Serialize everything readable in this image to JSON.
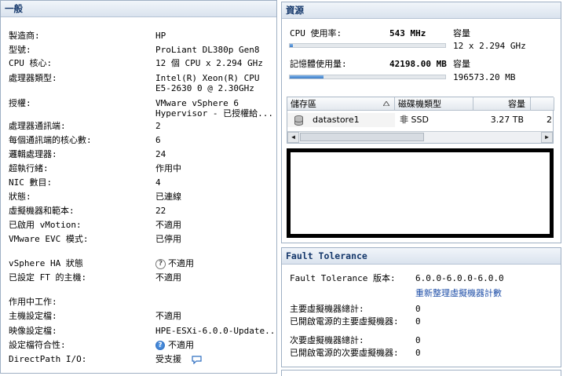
{
  "general": {
    "title": "一般",
    "rows": [
      {
        "key": "製造商:",
        "value": "HP"
      },
      {
        "key": "型號:",
        "value": "ProLiant DL380p Gen8"
      },
      {
        "key": "CPU 核心:",
        "value": "12 個 CPU x 2.294 GHz"
      },
      {
        "key": "處理器類型:",
        "value": "Intel(R) Xeon(R) CPU",
        "value2": "E5-2630 0 @ 2.30GHz"
      },
      {
        "key": "授權:",
        "value": "VMware vSphere 6",
        "value2": "Hypervisor - 已授權給..."
      },
      {
        "key": "處理器通訊端:",
        "value": "2"
      },
      {
        "key": "每個通訊端的核心數:",
        "value": "6"
      },
      {
        "key": "邏輯處理器:",
        "value": "24"
      },
      {
        "key": "超執行緒:",
        "value": "作用中"
      },
      {
        "key": "NIC 數目:",
        "value": "4"
      },
      {
        "key": "狀態:",
        "value": "已連線"
      },
      {
        "key": "虛擬機器和範本:",
        "value": "22"
      },
      {
        "key": "已啟用 vMotion:",
        "value": "不適用"
      },
      {
        "key": "VMware EVC 模式:",
        "value": "已停用"
      },
      {
        "key": "vSphere HA 狀態",
        "value": "不適用"
      },
      {
        "key": "已設定 FT 的主機:",
        "value": "不適用"
      },
      {
        "key": "作用中工作:",
        "value": ""
      },
      {
        "key": "主機設定檔:",
        "value": "不適用"
      },
      {
        "key": "映像設定檔:",
        "value": "HPE-ESXi-6.0.0-Update..."
      },
      {
        "key": "設定檔符合性:",
        "value": "不適用"
      },
      {
        "key": "DirectPath I/O:",
        "value": "受支援"
      }
    ]
  },
  "resources": {
    "title": "資源",
    "cpu": {
      "label": "CPU 使用率:",
      "value": "543 MHz",
      "cap_label": "容量",
      "capacity": "12 x 2.294 GHz",
      "fraction": 0.02
    },
    "mem": {
      "label": "記憶體使用量:",
      "value": "42198.00 MB",
      "cap_label": "容量",
      "capacity": "196573.20 MB",
      "fraction": 0.215
    },
    "table": {
      "headers": [
        "儲存區",
        "磁碟機類型",
        "容量"
      ],
      "rows": [
        {
          "name": "datastore1",
          "type": "非 SSD",
          "capacity": "3.27 TB",
          "more": "2"
        }
      ]
    }
  },
  "ft": {
    "title": "Fault Tolerance",
    "version_label": "Fault Tolerance 版本:",
    "version": "6.0.0-6.0.0-6.0.0",
    "refresh_link": "重新整理虛擬機器計數",
    "rows": [
      {
        "key": "主要虛擬機器總計:",
        "value": "0"
      },
      {
        "key": "已開啟電源的主要虛擬機器:",
        "value": "0"
      },
      {
        "key": "次要虛擬機器總計:",
        "value": "0"
      },
      {
        "key": "已開啟電源的次要虛擬機器:",
        "value": "0"
      }
    ]
  },
  "icons": [
    "info-icon",
    "help-icon",
    "chat-icon",
    "database-icon",
    "sort-arrow-icon",
    "scroll-left-icon",
    "scroll-right-icon"
  ]
}
